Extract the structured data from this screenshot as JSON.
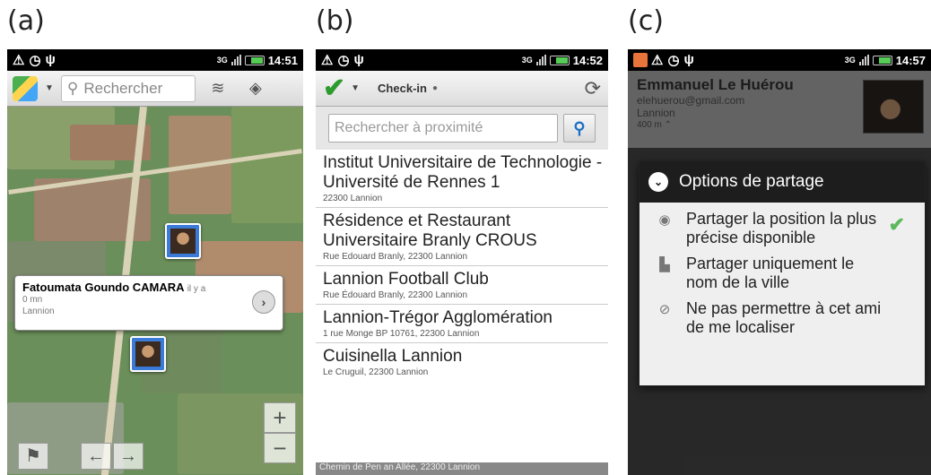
{
  "labels": {
    "a": "(a)",
    "b": "(b)",
    "c": "(c)"
  },
  "phone_a": {
    "status": {
      "network": "3G",
      "time": "14:51"
    },
    "search_placeholder": "Rechercher",
    "callout": {
      "name": "Fatoumata Goundo CAMARA",
      "time_prefix": "il y a",
      "time": "0 mn",
      "city": "Lannion"
    },
    "zoom_in": "+",
    "zoom_out": "−",
    "nav_prev": "←",
    "nav_next": "→"
  },
  "phone_b": {
    "status": {
      "network": "3G",
      "time": "14:52"
    },
    "title": "Check-in",
    "search_placeholder": "Rechercher à proximité",
    "places": [
      {
        "name": "Institut Universitaire de Technologie - Université de Rennes 1",
        "address": "22300 Lannion"
      },
      {
        "name": "Résidence et Restaurant Universitaire Branly CROUS",
        "address": "Rue Edouard Branly, 22300 Lannion"
      },
      {
        "name": "Lannion Football Club",
        "address": "Rue Édouard Branly, 22300 Lannion"
      },
      {
        "name": "Lannion-Trégor Agglomération",
        "address": "1 rue Monge BP 10761, 22300 Lannion"
      },
      {
        "name": "Cuisinella Lannion",
        "address": "Le Cruguil, 22300 Lannion"
      }
    ],
    "footer": "Chemin de Pen an Allée, 22300 Lannion"
  },
  "phone_c": {
    "status": {
      "network": "3G",
      "time": "14:57"
    },
    "profile": {
      "name": "Emmanuel Le Huérou",
      "email": "elehuerou@gmail.com",
      "city": "Lannion",
      "distance": "400 m"
    },
    "dialog_title": "Options de partage",
    "options": [
      {
        "label": "Partager la position la plus précise disponible",
        "icon": "precise-location-icon"
      },
      {
        "label": "Partager uniquement le nom de la ville",
        "icon": "city-icon"
      },
      {
        "label": "Ne pas permettre à cet ami de me localiser",
        "icon": "hidden-eye-icon"
      }
    ]
  },
  "colors": {
    "check_green": "#2e9b2e",
    "marker_blue": "#3b7bd8",
    "dialog_header": "#1d1d1d"
  }
}
